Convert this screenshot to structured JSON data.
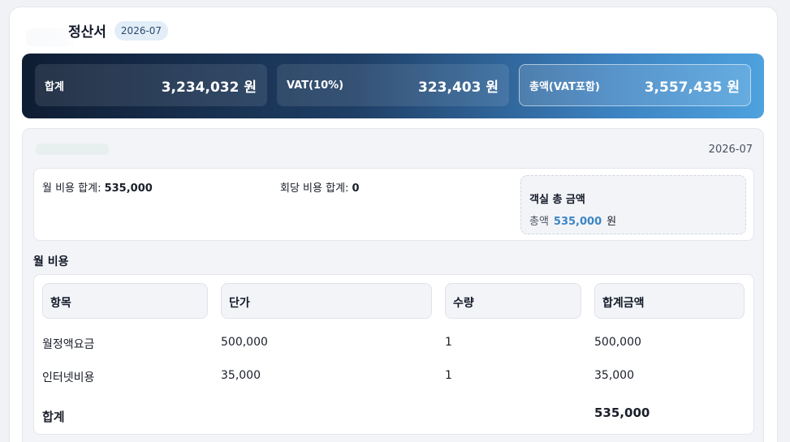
{
  "header": {
    "title": "정산서",
    "badge": "2026-07"
  },
  "summary": [
    {
      "label": "합계",
      "value": "3,234,032 원"
    },
    {
      "label": "VAT(10%)",
      "value": "323,403 원"
    },
    {
      "label": "총액(VAT포함)",
      "value": "3,557,435 원"
    }
  ],
  "panel": {
    "date": "2026-07",
    "stats": {
      "monthly_label": "월 비용 합계: ",
      "monthly_value": "535,000",
      "per_use_label": "회당 비용 합계: ",
      "per_use_value": "0"
    },
    "room_box": {
      "title": "객실 총 금액",
      "total_label": "총액",
      "total_value": "535,000",
      "unit": "원"
    },
    "section_title": "월 비용",
    "table": {
      "columns": [
        "항목",
        "단가",
        "수량",
        "합계금액"
      ],
      "rows": [
        [
          "월정액요금",
          "500,000",
          "1",
          "500,000"
        ],
        [
          "인터넷비용",
          "35,000",
          "1",
          "35,000"
        ]
      ],
      "footer_label": "합계",
      "footer_value": "535,000"
    }
  },
  "colors": {
    "accent": "#3a86c4",
    "summary_gradient_start": "#0f1d33",
    "summary_gradient_end": "#4ea2de"
  }
}
